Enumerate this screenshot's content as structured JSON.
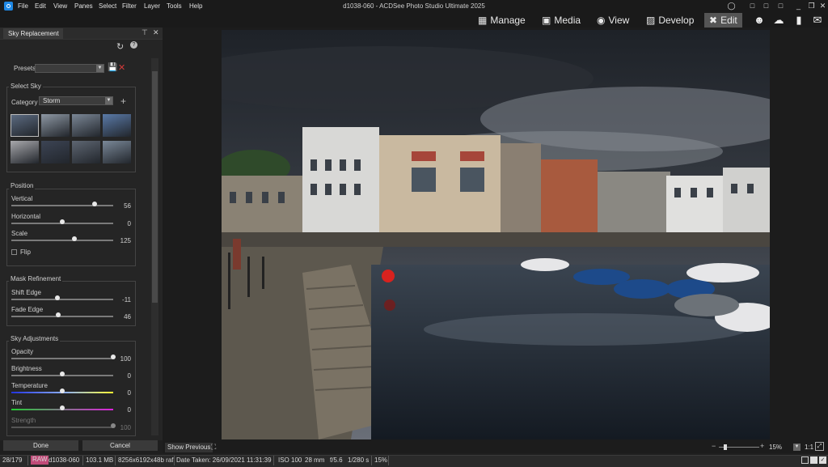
{
  "menu": [
    "File",
    "Edit",
    "View",
    "Panes",
    "Select",
    "Filter",
    "Layer",
    "Tools",
    "Help"
  ],
  "window_title": "d1038-060 - ACDSee Photo Studio Ultimate 2025",
  "modes": [
    {
      "label": "Manage",
      "icon": "grid-icon"
    },
    {
      "label": "Media",
      "icon": "media-icon"
    },
    {
      "label": "View",
      "icon": "eye-icon"
    },
    {
      "label": "Develop",
      "icon": "develop-icon"
    },
    {
      "label": "Edit",
      "icon": "edit-icon"
    }
  ],
  "panel": {
    "tab": "Sky Replacement",
    "presets_label": "Presets",
    "presets_value": "",
    "select_sky": {
      "title": "Select Sky",
      "category_label": "Category",
      "category_value": "Storm"
    },
    "position": {
      "title": "Position",
      "vertical": {
        "label": "Vertical",
        "value": "56",
        "pos": 0.82
      },
      "horizontal": {
        "label": "Horizontal",
        "value": "0",
        "pos": 0.5
      },
      "scale": {
        "label": "Scale",
        "value": "125",
        "pos": 0.62
      },
      "flip_label": "Flip"
    },
    "mask": {
      "title": "Mask Refinement",
      "shift_edge": {
        "label": "Shift Edge",
        "value": "-11",
        "pos": 0.45
      },
      "fade_edge": {
        "label": "Fade Edge",
        "value": "46",
        "pos": 0.46
      }
    },
    "adjust": {
      "title": "Sky Adjustments",
      "opacity": {
        "label": "Opacity",
        "value": "100",
        "pos": 1.0
      },
      "brightness": {
        "label": "Brightness",
        "value": "0",
        "pos": 0.5
      },
      "temperature": {
        "label": "Temperature",
        "value": "0",
        "pos": 0.5
      },
      "tint": {
        "label": "Tint",
        "value": "0",
        "pos": 0.5
      },
      "strength": {
        "label": "Strength",
        "value": "100",
        "pos": 1.0
      }
    },
    "done": "Done",
    "cancel": "Cancel"
  },
  "viewer": {
    "show_previous": "Show Previous",
    "zoom": "15%",
    "ratio": "1:1"
  },
  "status": {
    "index": "28/179",
    "raw": "RAW",
    "filename": "d1038-060",
    "size": "103.1 MB",
    "dims": "8256x6192x48b raf",
    "date": "Date Taken: 26/09/2021 11:31:39",
    "iso": "ISO 100",
    "focal": "28 mm",
    "aperture": "f/5.6",
    "shutter": "1/280 s",
    "zoom": "15%"
  },
  "colors": {
    "accent": "#1e88e5",
    "raw_badge": "#c04a78"
  }
}
